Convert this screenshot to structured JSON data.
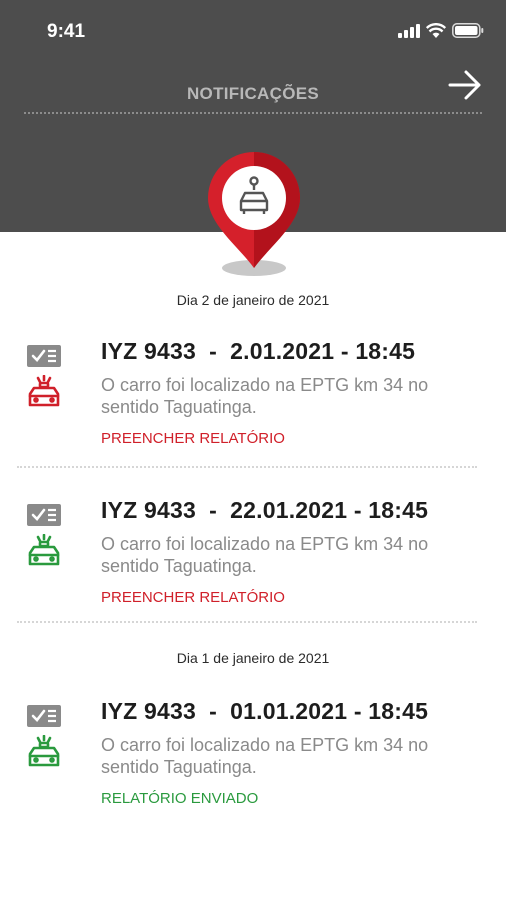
{
  "status_bar": {
    "time": "9:41"
  },
  "header": {
    "title": "NOTIFICAÇÕES"
  },
  "colors": {
    "header_bg": "#4d4d4d",
    "pin_red": "#d5202b",
    "action_red": "#d0202a",
    "action_green": "#2a9a3e",
    "icon_gray": "#8a8a8a"
  },
  "groups": [
    {
      "date_label": "Dia 2 de janeiro de 2021",
      "items": [
        {
          "title": "IYZ 9433  -  2.01.2021 - 18:45",
          "description": "O carro foi localizado na EPTG km 34 no sentido Taguatinga.",
          "action": "PREENCHER RELATÓRIO",
          "status": "pending",
          "car_icon": "police-car-red-icon"
        },
        {
          "title": "IYZ 9433  -  22.01.2021 - 18:45",
          "description": "O carro foi localizado na EPTG km 34 no sentido Taguatinga.",
          "action": "PREENCHER RELATÓRIO",
          "status": "pending",
          "car_icon": "police-car-green-icon"
        }
      ]
    },
    {
      "date_label": "Dia 1 de janeiro de 2021",
      "items": [
        {
          "title": "IYZ 9433  -  01.01.2021 - 18:45",
          "description": "O carro foi localizado na EPTG km 34 no sentido Taguatinga.",
          "action": "RELATÓRIO ENVIADO",
          "status": "sent",
          "car_icon": "police-car-green-icon"
        }
      ]
    }
  ],
  "icons": [
    "signal-icon",
    "wifi-icon",
    "battery-icon",
    "arrow-right-icon",
    "location-pin-icon",
    "checklist-icon"
  ]
}
